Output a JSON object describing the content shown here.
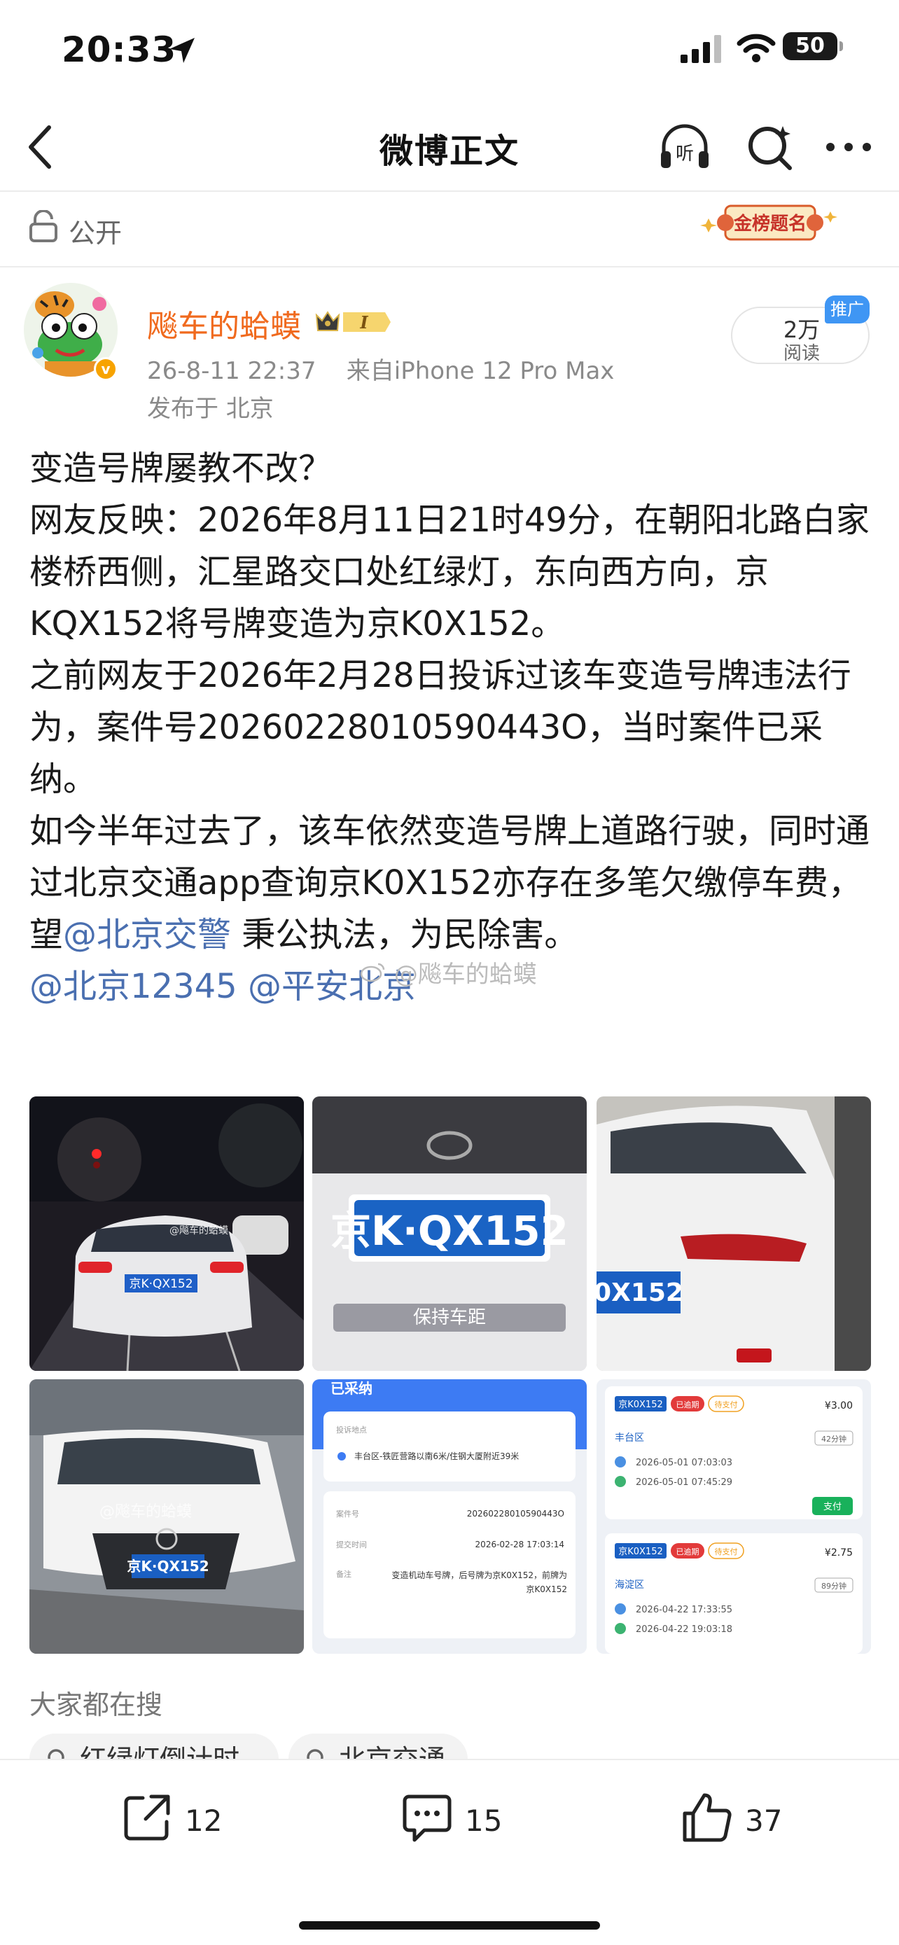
{
  "status_bar": {
    "time": "20:33",
    "battery": "50"
  },
  "nav": {
    "title": "微博正文"
  },
  "visibility": {
    "label": "公开"
  },
  "rank_badge": {
    "text": "金榜题名"
  },
  "author": {
    "name": "飚车的蛤蟆",
    "vip_level": "I",
    "timestamp": "26-8-11 22:37",
    "source": "来自iPhone 12 Pro Max",
    "location": "发布于 北京"
  },
  "reads": {
    "count": "2万",
    "label": "阅读",
    "promo": "推广"
  },
  "post": {
    "p1": "变造号牌屡教不改？",
    "p2": "网友反映：2026年8月11日21时49分，在朝阳北路白家楼桥西侧，汇星路交口处红绿灯，东向西方向，京KQX152将号牌变造为京K0X152。",
    "p3": "之前网友于2026年2月28日投诉过该车变造号牌违法行为，案件号20260228010590443O，当时案件已采纳。",
    "p4_before": "如今半年过去了，该车依然变造号牌上道路行驶，同时通过北京交通app查询京K0X152亦存在多笔欠缴停车费，望",
    "p4_mention": "@北京交警",
    "p4_after": " 秉公执法，为民除害。",
    "mention_1": "@北京12345",
    "mention_2": "@平安北京",
    "watermark": "@飚车的蛤蟆"
  },
  "images": {
    "img1_plate": "京K·QX152",
    "img1_wm": "@飚车的蛤蟆",
    "img2_plate": "京K·QX152",
    "img2_frame": "保持车距",
    "img3_plate": "0X152",
    "img4_plate": "京K·QX152",
    "img4_wm": "@飚车的蛤蟆",
    "img5": {
      "status": "已采纳",
      "loc_label": "投诉地点",
      "loc_value": "丰台区-铁匠营路以南6米/住钢大厦附近39米",
      "case_label": "案件号",
      "case_value": "20260228010590443O",
      "time_label": "提交时间",
      "time_value": "2026-02-28 17:03:14",
      "note_label": "备注",
      "note_value": "变造机动车号牌，后号牌为京K0X152，前牌为京K0X152"
    },
    "img6": {
      "r1_plate": "京K0X152",
      "r1_tag": "已逾期",
      "r1_tag2": "待支付",
      "r1_amount": "¥3.00",
      "r1_area": "丰台区",
      "r1_dur": "42分钟",
      "r1_in": "2026-05-01 07:03:03",
      "r1_out": "2026-05-01 07:45:29",
      "r1_pay": "支付",
      "r2_plate": "京K0X152",
      "r2_tag": "已逾期",
      "r2_tag2": "待支付",
      "r2_amount": "¥2.75",
      "r2_area": "海淀区",
      "r2_dur": "89分钟",
      "r2_in": "2026-04-22 17:33:55",
      "r2_out": "2026-04-22 19:03:18"
    }
  },
  "hot_search": {
    "title": "大家都在搜",
    "chips": [
      "红绿灯倒计时",
      "北京交通"
    ]
  },
  "actions": {
    "repost": "12",
    "comment": "15",
    "like": "37"
  },
  "colors": {
    "mention": "#4a6fb0",
    "username": "#f06a1e",
    "promo": "#3f96f4"
  }
}
